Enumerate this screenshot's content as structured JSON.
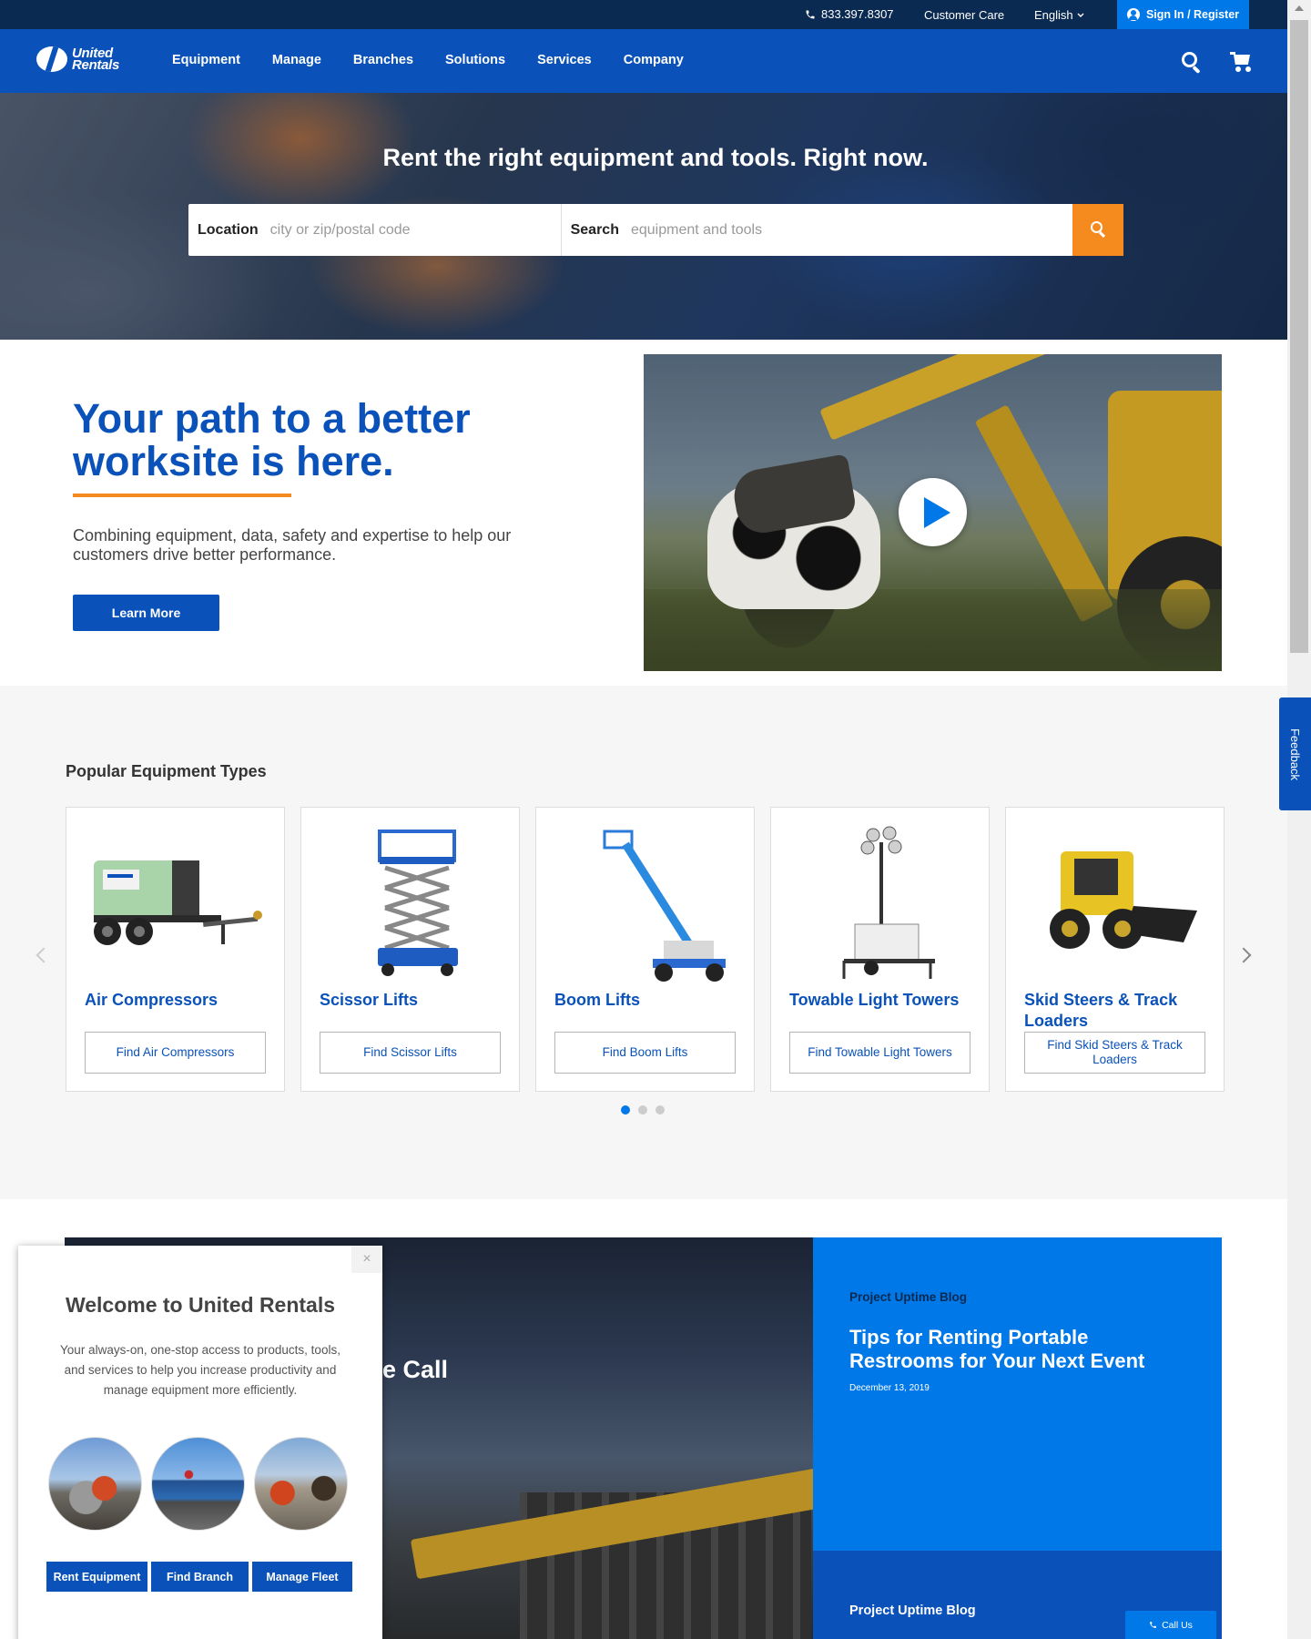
{
  "utility": {
    "phone": "833.397.8307",
    "customer_care": "Customer Care",
    "language": "English",
    "signin": "Sign In / Register"
  },
  "nav": {
    "logo_line1": "United",
    "logo_line2": "Rentals",
    "items": [
      "Equipment",
      "Manage",
      "Branches",
      "Solutions",
      "Services",
      "Company"
    ]
  },
  "hero": {
    "title": "Rent the right equipment and tools. Right now.",
    "location_label": "Location",
    "location_placeholder": "city or zip/postal code",
    "search_label": "Search",
    "search_placeholder": "equipment and tools"
  },
  "intro": {
    "title": "Your path to a better worksite is here.",
    "text": "Combining equipment, data, safety and expertise to help our customers drive better performance.",
    "button": "Learn More"
  },
  "popular": {
    "heading": "Popular Equipment Types",
    "cards": [
      {
        "title": "Air Compressors",
        "button": "Find Air Compressors"
      },
      {
        "title": "Scissor Lifts",
        "button": "Find Scissor Lifts"
      },
      {
        "title": "Boom Lifts",
        "button": "Find Boom Lifts"
      },
      {
        "title": "Towable Light Towers",
        "button": "Find Towable Light Towers"
      },
      {
        "title": "Skid Steers & Track Loaders",
        "button": "Find Skid Steers & Track Loaders"
      }
    ],
    "page_count": 3,
    "active_page": 1
  },
  "feature": {
    "dark_title_fragment": "ce Call",
    "blog_kicker": "Project Uptime Blog",
    "blog_title": "Tips for Renting Portable Restrooms for Your Next Event",
    "blog_date": "December 13, 2019",
    "blog2_kicker": "Project Uptime Blog",
    "call_us": "Call Us"
  },
  "modal": {
    "title": "Welcome to United Rentals",
    "text": "Your always-on, one-stop access to products, tools, and services to help you increase productivity and manage equipment more efficiently.",
    "close": "×",
    "buttons": [
      "Rent Equipment",
      "Find Branch",
      "Manage Fleet"
    ]
  },
  "feedback": "Feedback",
  "colors": {
    "brand_blue": "#0a52b9",
    "bright_blue": "#0078e7",
    "navy": "#0b2a52",
    "orange": "#f58b1f"
  }
}
